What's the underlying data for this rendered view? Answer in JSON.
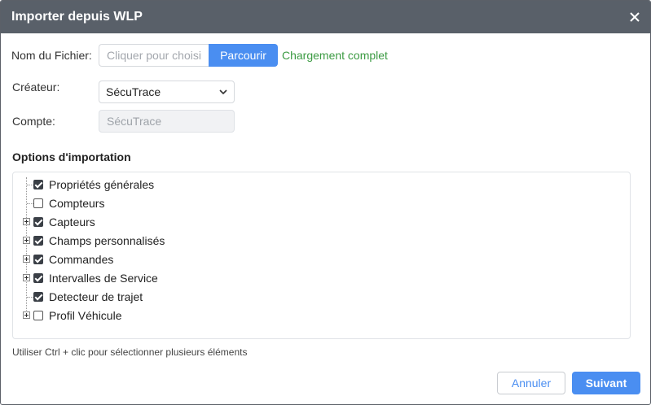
{
  "dialog": {
    "title": "Importer depuis WLP",
    "close_icon": "close-icon"
  },
  "form": {
    "file_label": "Nom du Fichier:",
    "file_placeholder": "Cliquer pour choisir",
    "browse_label": "Parcourir",
    "upload_status": "Chargement complet",
    "creator_label": "Créateur:",
    "creator_value": "SécuTrace",
    "account_label": "Compte:",
    "account_value": "SécuTrace"
  },
  "options": {
    "title": "Options d'importation",
    "items": [
      {
        "label": "Propriétés générales",
        "checked": true,
        "expandable": false
      },
      {
        "label": "Compteurs",
        "checked": false,
        "expandable": false
      },
      {
        "label": "Capteurs",
        "checked": true,
        "expandable": true
      },
      {
        "label": "Champs personnalisés",
        "checked": true,
        "expandable": true
      },
      {
        "label": "Commandes",
        "checked": true,
        "expandable": true
      },
      {
        "label": "Intervalles de Service",
        "checked": true,
        "expandable": true
      },
      {
        "label": "Detecteur de trajet",
        "checked": true,
        "expandable": false
      },
      {
        "label": "Profil Véhicule",
        "checked": false,
        "expandable": true
      }
    ]
  },
  "hint": "Utiliser Ctrl + clic pour sélectionner plusieurs éléments",
  "footer": {
    "cancel_label": "Annuler",
    "next_label": "Suivant"
  },
  "colors": {
    "titlebar": "#596069",
    "accent": "#4a8ef1",
    "success": "#3c9b43"
  }
}
